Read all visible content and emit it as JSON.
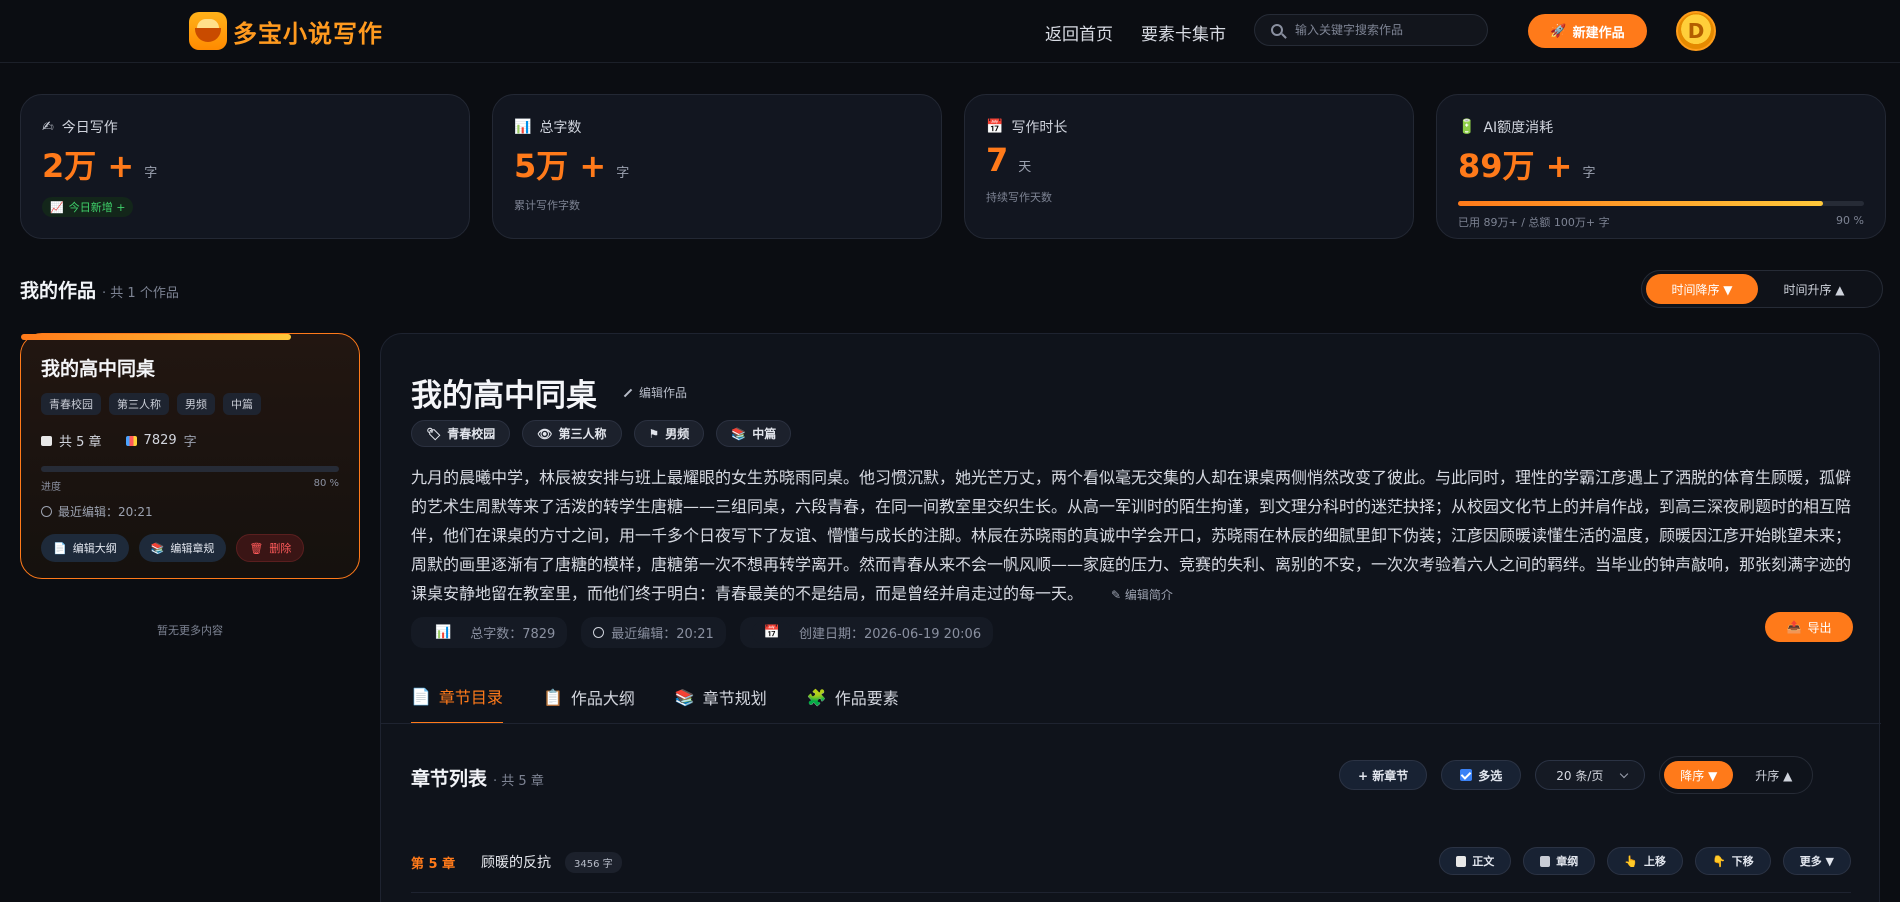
{
  "header": {
    "brand": "多宝小说写作",
    "nav": [
      "返回首页",
      "要素卡集市"
    ],
    "search_placeholder": "输入关键字搜索作品",
    "new_work_label": "新建作品",
    "avatar_letter": "D"
  },
  "stats": [
    {
      "icon": "writing-hand-icon",
      "label": "今日写作",
      "value": "2万 +",
      "unit": "字",
      "badge": "今日新增 +"
    },
    {
      "icon": "bar-chart-icon",
      "label": "总字数",
      "value": "5万 +",
      "unit": "字",
      "sub": "累计写作字数"
    },
    {
      "icon": "calendar-icon",
      "label": "写作时长",
      "value": "7",
      "unit": "天",
      "sub": "持续写作天数"
    },
    {
      "icon": "battery-icon",
      "label": "AI额度消耗",
      "value": "89万 +",
      "unit": "字",
      "usage": "已用 89万+ / 总额 100万+ 字",
      "percent": "90 %",
      "progress": 0.9
    }
  ],
  "works_section": {
    "title": "我的作品",
    "count": "· 共 1 个作品",
    "sort_options": [
      "时间降序 ▼",
      "时间升序 ▲"
    ]
  },
  "work_card": {
    "title": "我的高中同桌",
    "tags": [
      "青春校园",
      "第三人称",
      "男频",
      "中篇"
    ],
    "chapters": "共 5 章",
    "words": "7829",
    "words_unit": "字",
    "progress_label": "进度",
    "progress_percent": "80 %",
    "progress": 0.8,
    "last_edit": "最近编辑：20:21",
    "buttons": [
      "编辑大纲",
      "编辑章规",
      "删除"
    ],
    "empty_hint": "暂无更多内容"
  },
  "detail": {
    "title": "我的高中同桌",
    "edit_label": "编辑作品",
    "tags": [
      "青春校园",
      "第三人称",
      "男频",
      "中篇"
    ],
    "synopsis": "九月的晨曦中学，林辰被安排与班上最耀眼的女生苏晓雨同桌。他习惯沉默，她光芒万丈，两个看似毫无交集的人却在课桌两侧悄然改变了彼此。与此同时，理性的学霸江彦遇上了洒脱的体育生顾暖，孤僻的艺术生周默等来了活泼的转学生唐糖——三组同桌，六段青春，在同一间教室里交织生长。从高一军训时的陌生拘谨，到文理分科时的迷茫抉择；从校园文化节上的并肩作战，到高三深夜刷题时的相互陪伴，他们在课桌的方寸之间，用一千多个日夜写下了友谊、懵懂与成长的注脚。林辰在苏晓雨的真诚中学会开口，苏晓雨在林辰的细腻里卸下伪装；江彦因顾暖读懂生活的温度，顾暖因江彦开始眺望未来；周默的画里逐渐有了唐糖的模样，唐糖第一次不想再转学离开。然而青春从来不会一帆风顺——家庭的压力、竞赛的失利、离别的不安，一次次考验着六人之间的羁绊。当毕业的钟声敲响，那张刻满字迹的课桌安静地留在教室里，而他们终于明白：青春最美的不是结局，而是曾经并肩走过的每一天。",
    "edit_synopsis": "编辑简介",
    "meta": [
      "总字数：7829",
      "最近编辑：20:21",
      "创建日期：2026-06-19 20:06"
    ],
    "export_label": "导出",
    "tabs": [
      "章节目录",
      "作品大纲",
      "章节规划",
      "作品要素"
    ]
  },
  "chapter_list": {
    "title": "章节列表",
    "count": "· 共 5 章",
    "new_chapter": "+ 新章节",
    "multi_select": "多选",
    "page_size": "20 条/页",
    "order_options": [
      "降序 ▼",
      "升序 ▲"
    ],
    "rows": [
      {
        "num": "第 5 章",
        "name": "顾暖的反抗",
        "words": "3456 字",
        "actions": [
          "正文",
          "章纲",
          "上移",
          "下移",
          "更多 ▼"
        ]
      }
    ]
  },
  "colors": {
    "accent": "#ff7a1a",
    "bg": "#0b0d12",
    "card": "#121620"
  }
}
